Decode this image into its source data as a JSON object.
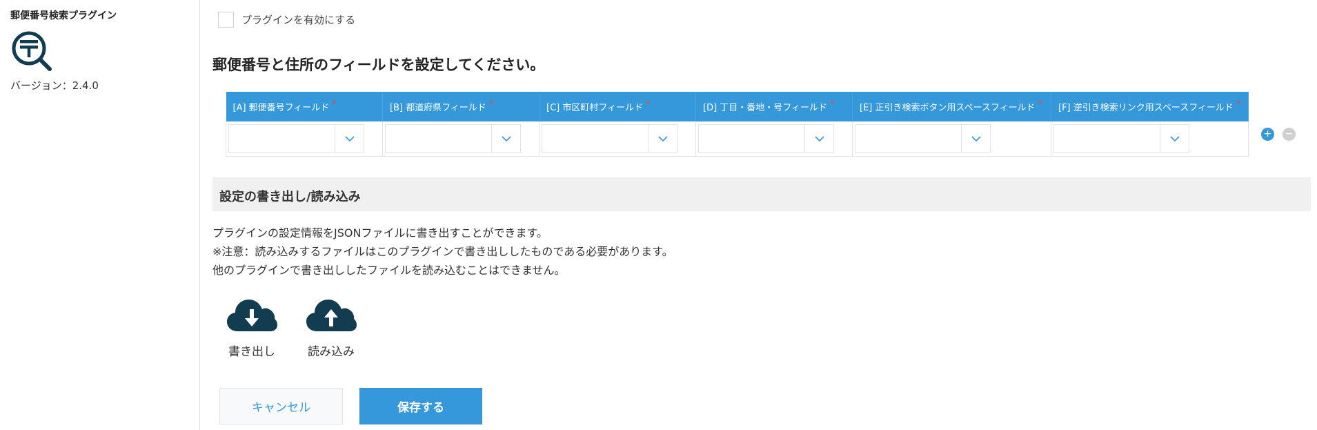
{
  "sidebar": {
    "plugin_name": "郵便番号検索プラグイン",
    "version": "バージョン：2.4.0",
    "logo_icon": "postal-search-icon"
  },
  "settings": {
    "enable_label": "プラグインを有効にする",
    "enabled": false,
    "section_title": "郵便番号と住所のフィールドを設定してください。",
    "columns": [
      {
        "label": "[A] 郵便番号フィールド",
        "required": "*"
      },
      {
        "label": "[B] 都道府県フィールド",
        "required": "*"
      },
      {
        "label": "[C] 市区町村フィールド",
        "required": "*"
      },
      {
        "label": "[D] 丁目・番地・号フィールド",
        "required": "*"
      },
      {
        "label": "[E] 正引き検索ボタン用スペースフィールド",
        "required": "*"
      },
      {
        "label": "[F] 逆引き検索リンク用スペースフィールド",
        "required": "*"
      }
    ],
    "add_row": "+",
    "remove_row": "−"
  },
  "export_section": {
    "title": "設定の書き出し/読み込み",
    "description": [
      "プラグインの設定情報をJSONファイルに書き出すことができます。",
      "※注意：読み込みするファイルはこのプラグインで書き出ししたものである必要があります。",
      "他のプラグインで書き出ししたファイルを読み込むことはできません。"
    ],
    "export_label": "書き出し",
    "import_label": "読み込み"
  },
  "actions": {
    "cancel": "キャンセル",
    "save": "保存する"
  },
  "colors": {
    "accent": "#3498db",
    "required": "#e74c3c",
    "icon_dark": "#123c4f"
  }
}
